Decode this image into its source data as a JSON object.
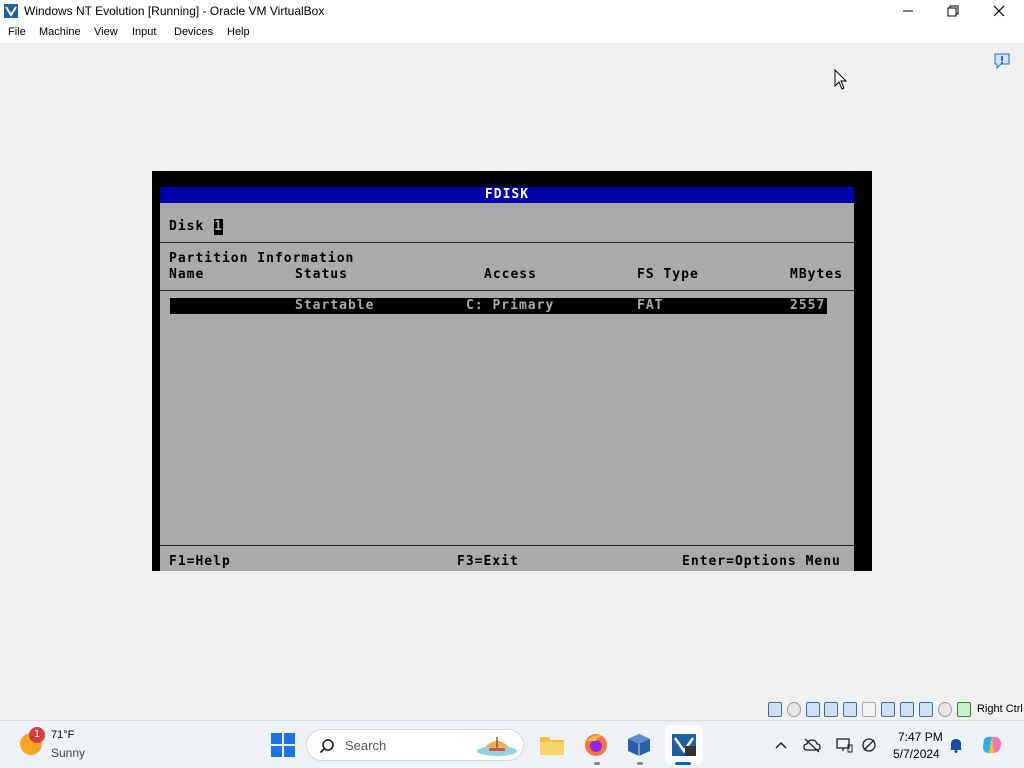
{
  "window": {
    "title": "Windows NT Evolution [Running] - Oracle VM VirtualBox"
  },
  "menu": {
    "items": [
      "File",
      "Machine",
      "View",
      "Input",
      "Devices",
      "Help"
    ]
  },
  "fdisk": {
    "title": "FDISK",
    "disk_label": "Disk",
    "disk_number": "1",
    "section_heading": "Partition Information",
    "columns": [
      "Name",
      "Status",
      "Access",
      "FS Type",
      "MBytes"
    ],
    "partitions": [
      {
        "name": "",
        "status": "Startable",
        "access": "C: Primary",
        "fs_type": "FAT",
        "mbytes": "2557"
      }
    ],
    "footer": {
      "help": "F1=Help",
      "exit": "F3=Exit",
      "options": "Enter=Options Menu"
    },
    "colors": {
      "title_bar": "#0000aa",
      "panel": "#aaaaaa",
      "highlight": "#000000"
    }
  },
  "vbox_status": {
    "host_key": "Right Ctrl"
  },
  "taskbar": {
    "weather": {
      "temperature": "71°F",
      "condition": "Sunny",
      "badge": "1"
    },
    "search": {
      "label": "Search"
    },
    "clock": {
      "time": "7:47 PM",
      "date": "5/7/2024"
    },
    "pinned_icons": [
      "start-icon",
      "search-icon",
      "file-explorer-icon",
      "firefox-icon",
      "virtualbox-icon",
      "windows-nt-vm-icon"
    ],
    "tray_icons": [
      "chevron-up-icon",
      "cloud-icon",
      "display-icon",
      "wifi-icon",
      "bell-icon",
      "copilot-icon"
    ]
  }
}
